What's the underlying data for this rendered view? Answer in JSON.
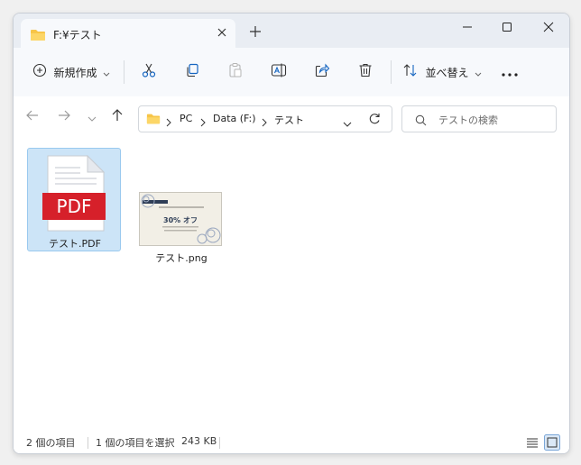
{
  "window": {
    "tab_title": "F:¥テスト",
    "controls": [
      "minimize",
      "maximize",
      "close"
    ]
  },
  "toolbar": {
    "new_label": "新規作成",
    "sort_label": "並べ替え",
    "actions": [
      "cut",
      "copy",
      "paste",
      "rename",
      "share",
      "delete"
    ]
  },
  "address": {
    "crumbs": [
      "PC",
      "Data (F:)",
      "テスト"
    ]
  },
  "search": {
    "placeholder": "テストの検索"
  },
  "files": [
    {
      "name": "テスト.PDF",
      "type": "pdf",
      "selected": true,
      "icon_text": "PDF"
    },
    {
      "name": "テスト.png",
      "type": "png",
      "selected": false,
      "thumb_text": "30% オフ"
    }
  ],
  "status": {
    "count": "2 個の項目",
    "selection": "1 個の項目を選択",
    "size": "243 KB"
  },
  "colors": {
    "accent": "#0067c0",
    "selection_bg": "#cce4f7",
    "pdf_red": "#d6202a",
    "folder_yellow": "#f7c548"
  }
}
